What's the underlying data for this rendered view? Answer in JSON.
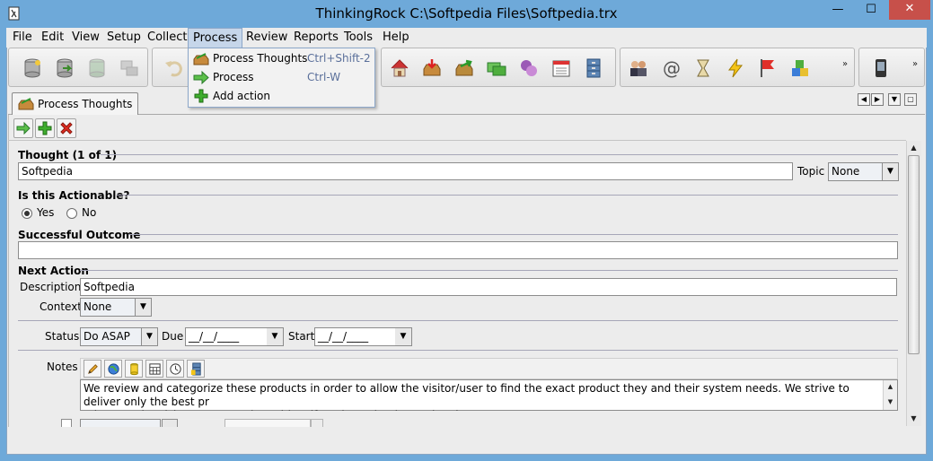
{
  "window": {
    "title": "ThinkingRock C:\\Softpedia Files\\Softpedia.trx",
    "minimize": "—",
    "maximize": "☐",
    "close": "✕"
  },
  "menubar": {
    "items": [
      "File",
      "Edit",
      "View",
      "Setup",
      "Collect",
      "Process",
      "Review",
      "Reports",
      "Tools",
      "Help"
    ]
  },
  "process_menu": {
    "items": [
      {
        "label": "Process Thoughts",
        "shortcut": "Ctrl+Shift-2",
        "icon": "process-thoughts-icon"
      },
      {
        "label": "Process",
        "shortcut": "Ctrl-W",
        "icon": "process-arrow-icon"
      },
      {
        "label": "Add action",
        "shortcut": "",
        "icon": "add-plus-icon"
      }
    ]
  },
  "toolbar": {
    "overflow": "»"
  },
  "tab": {
    "label": "Process Thoughts"
  },
  "form": {
    "thought_label": "Thought (1 of 1)",
    "thought_value": "Softpedia",
    "topic_label": "Topic",
    "topic_value": "None",
    "actionable_label": "Is this Actionable?",
    "yes_label": "Yes",
    "no_label": "No",
    "outcome_label": "Successful Outcome",
    "outcome_value": "",
    "next_action_label": "Next Action",
    "description_label": "Description",
    "description_value": "Softpedia",
    "context_label": "Context",
    "context_value": "None",
    "status_label": "Status",
    "status_value": "Do ASAP",
    "due_label": "Due",
    "due_value": "__/__/____",
    "start_label": "Start",
    "start_value": "__/__/____",
    "notes_label": "Notes",
    "notes_text": "We review and categorize these products in order to allow the visitor/user to find the exact product they and their system needs. We strive to deliver only the best pr\noducts to the visitor/user together with self-made evaluation and review notes."
  },
  "colors": {
    "frame": "#6ea9d9",
    "client": "#ececec",
    "close_button": "#c7504a",
    "menu_highlight": "#c6d6ea"
  }
}
